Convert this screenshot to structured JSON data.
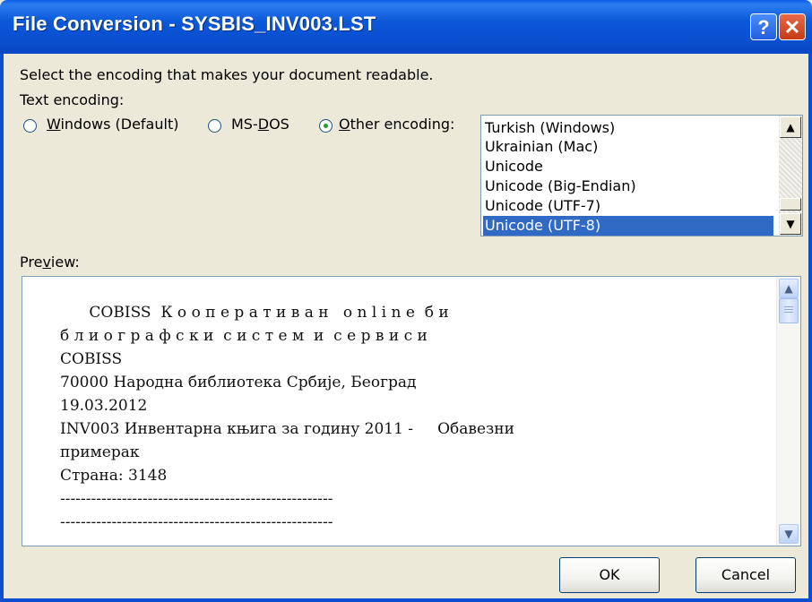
{
  "window": {
    "title": "File Conversion - SYSBIS_INV003.LST",
    "help_button": "?",
    "close_button": "✕"
  },
  "instructions": "Select the encoding that makes your document readable.",
  "text_encoding_label": "Text encoding:",
  "options": [
    {
      "mnemonic": "W",
      "rest": "indows (Default)",
      "selected": false
    },
    {
      "pre": "MS-",
      "mnemonic": "D",
      "rest": "OS",
      "selected": false
    },
    {
      "mnemonic": "O",
      "rest": "ther encoding:",
      "selected": true
    }
  ],
  "encoding_list": {
    "items": [
      "Turkish (Windows)",
      "Ukrainian (Mac)",
      "Unicode",
      "Unicode (Big-Endian)",
      "Unicode (UTF-7)",
      "Unicode (UTF-8)"
    ],
    "selected": "Unicode (UTF-8)"
  },
  "preview": {
    "label_pre": "Pre",
    "label_mnemonic": "v",
    "label_rest": "iew:",
    "lines": [
      "      COBISS  К о о п е р а т и в а н   o n l i n e  б и",
      "б л и о г р а ф с к и  с и с т е м  и  с е р в и с и",
      "COBISS",
      "70000 Народна библиотека Србије, Београд",
      "19.03.2012",
      "INV003 Инвентарна књига за годину 2011 -     Обавезни",
      "примерак",
      "Страна: 3148",
      "-----------------------------------------------------",
      "-----------------------------------------------------"
    ]
  },
  "buttons": {
    "ok": "OK",
    "cancel": "Cancel"
  }
}
